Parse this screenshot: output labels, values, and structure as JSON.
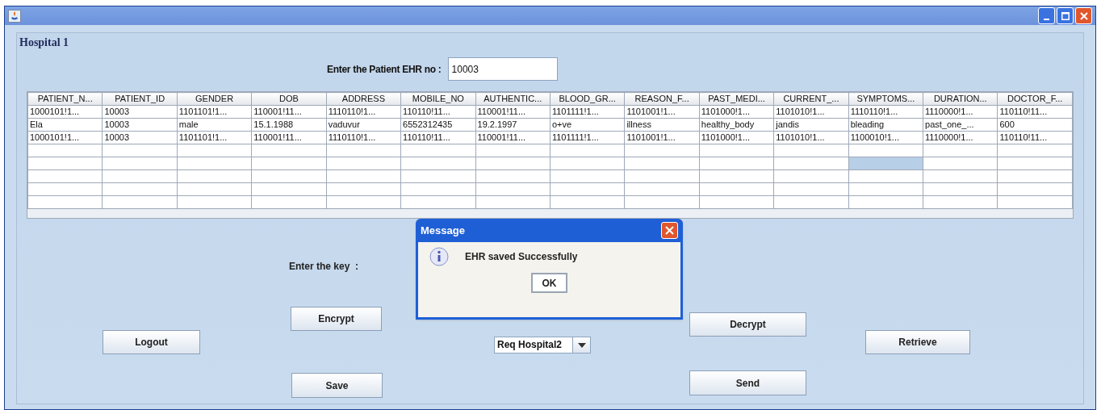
{
  "panel": {
    "title": "Hospital 1"
  },
  "ehr_field": {
    "label": "Enter the Patient EHR no :",
    "value": "10003"
  },
  "table": {
    "columns": [
      "PATIENT_N...",
      "PATIENT_ID",
      "GENDER",
      "DOB",
      "ADDRESS",
      "MOBILE_NO",
      "AUTHENTIC...",
      "BLOOD_GR...",
      "REASON_F...",
      "PAST_MEDI...",
      "CURRENT_...",
      "SYMPTOMS...",
      "DURATION...",
      "DOCTOR_F..."
    ],
    "rows": [
      [
        "1000101!1...",
        "10003",
        "1101101!1...",
        "110001!11...",
        "1110110!1...",
        "110110!11...",
        "110001!11...",
        "1101111!1...",
        "1101001!1...",
        "1101000!1...",
        "1101010!1...",
        "1110110!1...",
        "1110000!1...",
        "110110!11..."
      ],
      [
        "Ela",
        "10003",
        "male",
        "15.1.1988",
        "vaduvur",
        "6552312435",
        "19.2.1997",
        "o+ve",
        "illness",
        "healthy_body",
        "jandis",
        "bleading",
        "past_one_...",
        "600"
      ],
      [
        "1000101!1...",
        "10003",
        "1101101!1...",
        "110001!11...",
        "1110110!1...",
        "110110!11...",
        "110001!11...",
        "1101111!1...",
        "1101001!1...",
        "1101000!1...",
        "1101010!1...",
        "1100010!1...",
        "1110000!1...",
        "110110!11..."
      ]
    ],
    "empty_rows": [
      {
        "cells_selected": [
          false,
          false,
          false,
          false,
          false,
          false,
          false,
          false,
          false,
          false,
          false,
          false,
          false,
          false
        ]
      },
      {
        "cells_selected": [
          false,
          false,
          false,
          false,
          false,
          false,
          false,
          false,
          false,
          false,
          false,
          true,
          false,
          false
        ]
      },
      {
        "cells_selected": [
          false,
          false,
          false,
          false,
          false,
          false,
          false,
          false,
          false,
          false,
          false,
          false,
          false,
          false
        ]
      },
      {
        "cells_selected": [
          false,
          false,
          false,
          false,
          false,
          false,
          false,
          false,
          false,
          false,
          false,
          false,
          false,
          false
        ]
      },
      {
        "cells_selected": [
          false,
          false,
          false,
          false,
          false,
          false,
          false,
          false,
          false,
          false,
          false,
          false,
          false,
          false
        ]
      }
    ]
  },
  "key_label": "Enter the key  :",
  "buttons": {
    "logout": "Logout",
    "encrypt": "Encrypt",
    "save": "Save",
    "decrypt": "Decrypt",
    "send": "Send",
    "retrieve": "Retrieve"
  },
  "hospital_select": {
    "value": "Req Hospital2"
  },
  "dialog": {
    "title": "Message",
    "message": "EHR saved Successfully",
    "button": "OK"
  }
}
